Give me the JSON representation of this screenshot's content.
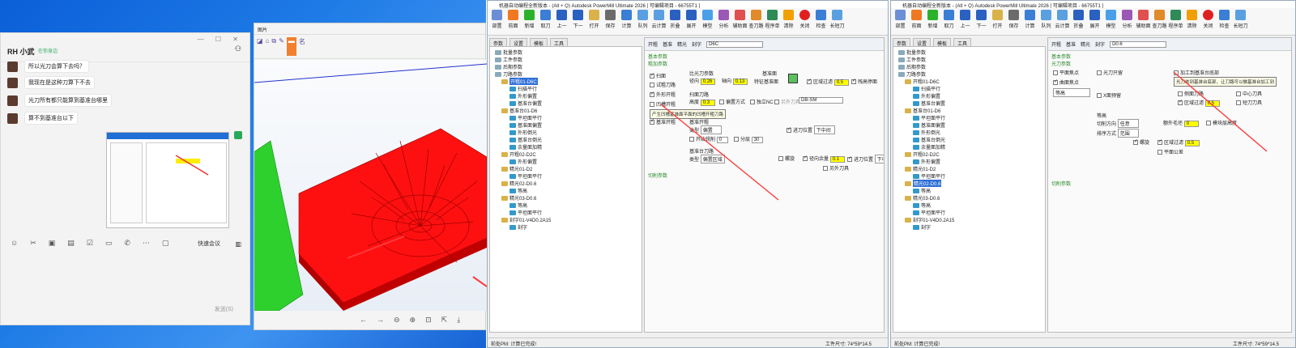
{
  "chat": {
    "name": "RH 小武",
    "status": "在你身边",
    "messages": [
      "所以光刀会算下去吗？",
      "我现在是这种刀算下不去",
      "光刀所有都只能算到基准台哪里",
      "算不到基准台以下"
    ],
    "quick_meeting": "快速会议",
    "send_label": "发送(S)"
  },
  "viewer": {
    "title": "图片",
    "tool_icons": [
      "◪",
      "⌂",
      "⧉",
      "✎",
      "▬",
      "名"
    ]
  },
  "pm_left": {
    "title": "机器自动编程全新版本 - (Alt + Q) Autodesk PowerMill Ultimate 2026   [ 可编辑项目 - 66755T1 ]",
    "ribbon": [
      "部置",
      "前面",
      "新增",
      "取刀",
      "上一",
      "下一",
      "打开",
      "保存",
      "计算",
      "队列",
      "云计算",
      "折叠",
      "展开",
      "模型",
      "分析",
      "辅助面",
      "查刀路",
      "程序单",
      "清除",
      "关闭",
      "检查",
      "长短刀",
      "报告"
    ],
    "tabs": [
      "参数",
      "设置",
      "模板",
      "工具"
    ],
    "tree": [
      "批量参数",
      "工件参数",
      "后期参数",
      "刀路参数",
      "开粗01-D6C",
      "扫描平行",
      "外形偏置",
      "基准台偏置",
      "基准台01-D6",
      "平坦面平行",
      "基准面偏置",
      "外形倒光",
      "基准台倒光",
      "余量面加精",
      "开粗02-D2C",
      "外形偏置",
      "精光01-D2",
      "平坦面平行",
      "精光02-D0.6",
      "等高",
      "精光03-D0.6",
      "等高",
      "平坦面平行",
      "刻字01-V4D0.2A15",
      "刻字"
    ],
    "sub": {
      "rough": "开粗",
      "ref": "基准",
      "light": "精光",
      "mark": "刻字",
      "tool": "D6C"
    },
    "fields": {
      "basic_params": "基本参数",
      "rough_params": "粗加参数",
      "scan": "扫面",
      "rough_knife": "试粗刀路",
      "outside": "外形开粗",
      "down": "凹槽开粗",
      "ext": "基准开粗",
      "ratio": "比光刀参数",
      "dia_lbl": "径向",
      "dia_val": "0.26",
      "axial_lbl": "轴向",
      "axial_val": "0.13",
      "base_face": "基准面",
      "special": "特征基准面",
      "zone_filter": "区域过滤",
      "zone_val": "0.5",
      "peak": "残高停面",
      "scan_cut": "扫面刀路",
      "height": "高度",
      "height_val": "0.3",
      "offset_mode": "偏置方式",
      "sep_nc": "独立NC",
      "other_knife": "另外刀具",
      "db_sm": "DB-SM",
      "tip": "产生凹槽基准面平面的凹槽开粗刀路",
      "layer": "基准开粗",
      "type_lbl": "类型",
      "type_val": "偏置",
      "cut_lbl": "开始铣削",
      "cut_v": "0",
      "split": "分层",
      "split_v": "30",
      "feed": "进刀位置",
      "feed_v": "下中间",
      "bcut": "基准台刀路",
      "bt": "类型",
      "bt_v": "偏置区域",
      "spiral": "螺旋",
      "radial": "径向余量",
      "radial_v": "0.1",
      "in_pos": "进刀位置",
      "in_pos_v": "下中",
      "other": "另外刀具",
      "cut_param": "切削参数"
    },
    "status": "前处PM: 计算已完成!",
    "size": "工件尺寸:    74*59*14.5"
  },
  "pm_right": {
    "title": "机器自动编程全新版本 - (Alt + Q) Autodesk PowerMill Ultimate 2026   [ 可编辑项目 - 66755T1 ]",
    "tree_sel": "精光02-D0.6",
    "sub": {
      "tool": "D0.6"
    },
    "fields": {
      "basic": "基本参数",
      "light": "光刀参数",
      "flat": "平面焦点",
      "curved": "曲面焦点",
      "light_face": "光刀只留",
      "opt": "等高",
      "skip": "X面预留",
      "add_base": "加工到基准台底部",
      "tip": "光刀依到基准台底部，让刀路可以做基准台加工到",
      "side": "侧面刀路",
      "mid": "中心刀具",
      "zone": "区域过滤",
      "zone_v": "0.5",
      "short": "短刀刀具",
      "layer": "等高",
      "dir": "切削方向",
      "dir_v": "任意",
      "outer": "额外毛坯",
      "outer_v": "0",
      "order": "排序方式",
      "order_v": "范围",
      "spiral": "螺旋",
      "zone2": "区域过滤",
      "zone2_v": "0.5",
      "peak": "模块层高度",
      "plane": "平面公差",
      "cut_param": "切削参数"
    },
    "status": "前处PM: 计算已完成!",
    "size": "工件尺寸:    74*59*14.5"
  }
}
